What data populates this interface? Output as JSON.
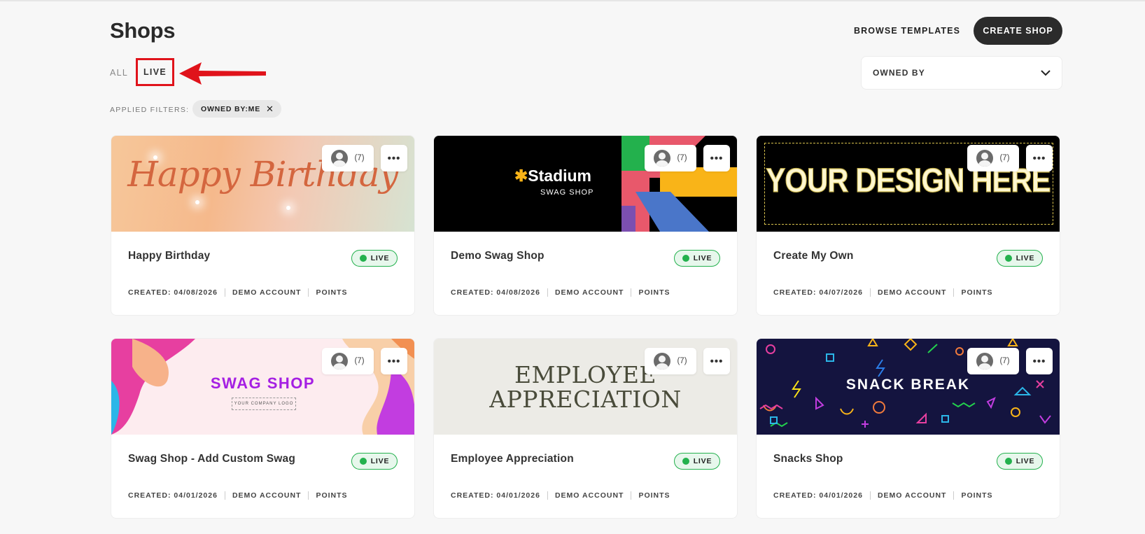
{
  "header": {
    "title": "Shops",
    "browse_label": "BROWSE TEMPLATES",
    "create_label": "CREATE SHOP"
  },
  "filters": {
    "tabs": [
      "ALL",
      "LIVE"
    ],
    "owned_by_label": "OWNED BY",
    "applied_label": "APPLIED FILTERS:",
    "applied_chip": "OWNED BY:ME"
  },
  "shops": [
    {
      "name": "Happy Birthday",
      "banner_text": "Happy Birthday",
      "members": "(7)",
      "status": "LIVE",
      "created": "CREATED: 04/08/2026",
      "account": "DEMO ACCOUNT",
      "type": "POINTS"
    },
    {
      "name": "Demo Swag Shop",
      "banner_text": "Stadium",
      "banner_sub": "SWAG SHOP",
      "members": "(7)",
      "status": "LIVE",
      "created": "CREATED: 04/08/2026",
      "account": "DEMO ACCOUNT",
      "type": "POINTS"
    },
    {
      "name": "Create My Own",
      "banner_text": "YOUR DESIGN HERE",
      "members": "(7)",
      "status": "LIVE",
      "created": "CREATED: 04/07/2026",
      "account": "DEMO ACCOUNT",
      "type": "POINTS"
    },
    {
      "name": "Swag Shop - Add Custom Swag",
      "banner_text": "SWAG SHOP",
      "banner_sub": "YOUR COMPANY LOGO",
      "members": "(7)",
      "status": "LIVE",
      "created": "CREATED: 04/01/2026",
      "account": "DEMO ACCOUNT",
      "type": "POINTS"
    },
    {
      "name": "Employee Appreciation",
      "banner_text": "EMPLOYEE",
      "banner_sub": "APPRECIATION",
      "members": "(7)",
      "status": "LIVE",
      "created": "CREATED: 04/01/2026",
      "account": "DEMO ACCOUNT",
      "type": "POINTS"
    },
    {
      "name": "Snacks Shop",
      "banner_text": "SNACK BREAK",
      "members": "(7)",
      "status": "LIVE",
      "created": "CREATED: 04/01/2026",
      "account": "DEMO ACCOUNT",
      "type": "POINTS"
    }
  ],
  "more_icon": "ellipsis-icon",
  "colors": {
    "live_green": "#23b14d",
    "highlight_red": "#e0131b",
    "primary_dark": "#2b2b2b"
  }
}
